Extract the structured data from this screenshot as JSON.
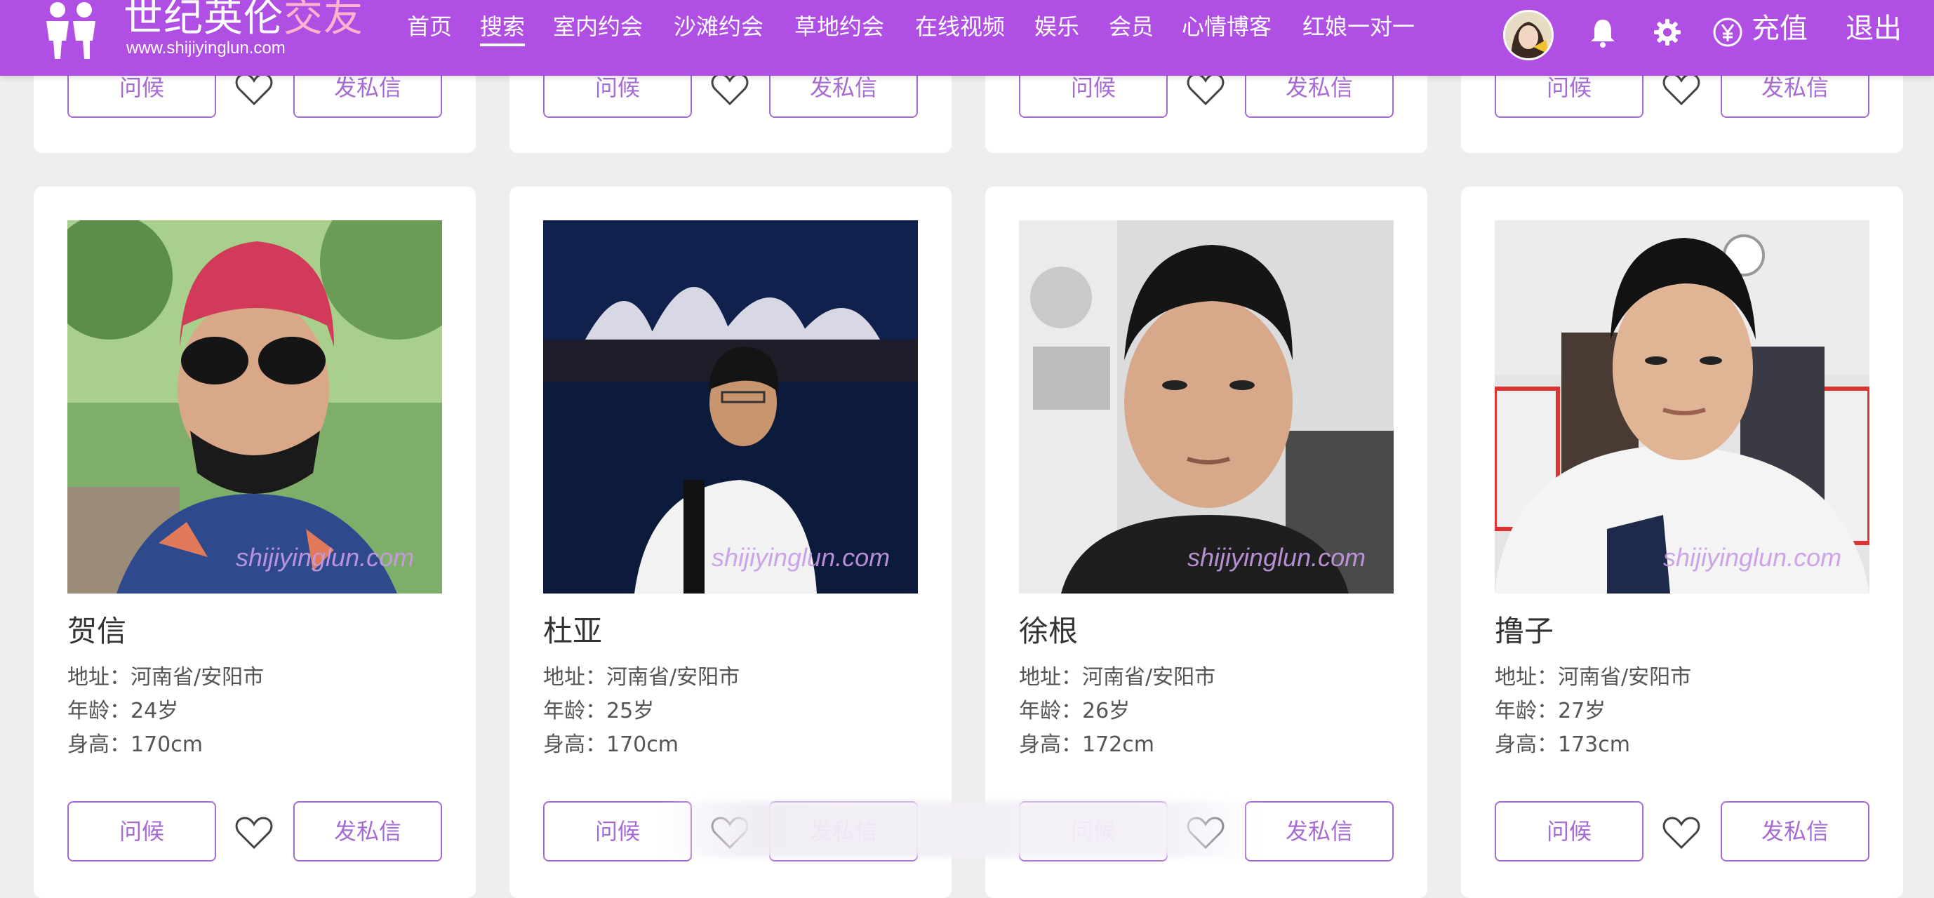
{
  "site": {
    "title_main": "世纪英伦",
    "title_accent": "交友",
    "url": "www.shijiyinglun.com"
  },
  "nav": [
    {
      "label": "首页",
      "active": false
    },
    {
      "label": "搜索",
      "active": true
    },
    {
      "label": "室内约会",
      "active": false
    },
    {
      "label": "沙滩约会",
      "active": false
    },
    {
      "label": "草地约会",
      "active": false
    },
    {
      "label": "在线视频",
      "active": false
    },
    {
      "label": "娱乐",
      "active": false
    },
    {
      "label": "会员",
      "active": false
    },
    {
      "label": "心情博客",
      "active": false
    },
    {
      "label": "红娘一对一",
      "active": false
    }
  ],
  "header_right": {
    "avatar_icon": "user-avatar",
    "bell_icon": "bell-icon",
    "gear_icon": "gear-icon",
    "yuan_icon": "yuan-icon",
    "recharge_label": "充值",
    "logout_label": "退出"
  },
  "labels": {
    "greet": "问候",
    "message": "发私信",
    "address_prefix": "地址：",
    "age_prefix": "年龄：",
    "height_prefix": "身高："
  },
  "watermark": "shijiyinglun.com",
  "profiles": [
    {
      "name": "贺信",
      "address": "地址：河南省/安阳市",
      "age": "年龄：24岁",
      "height": "身高：170cm"
    },
    {
      "name": "杜亚",
      "address": "地址：河南省/安阳市",
      "age": "年龄：25岁",
      "height": "身高：170cm"
    },
    {
      "name": "徐根",
      "address": "地址：河南省/安阳市",
      "age": "年龄：26岁",
      "height": "身高：172cm"
    },
    {
      "name": "撸子",
      "address": "地址：河南省/安阳市",
      "age": "年龄：27岁",
      "height": "身高：173cm"
    }
  ],
  "colors": {
    "header": "#b04fe3",
    "accent": "#a76bd4",
    "logo_accent": "#ffb3cd",
    "background": "#eeeeee"
  }
}
